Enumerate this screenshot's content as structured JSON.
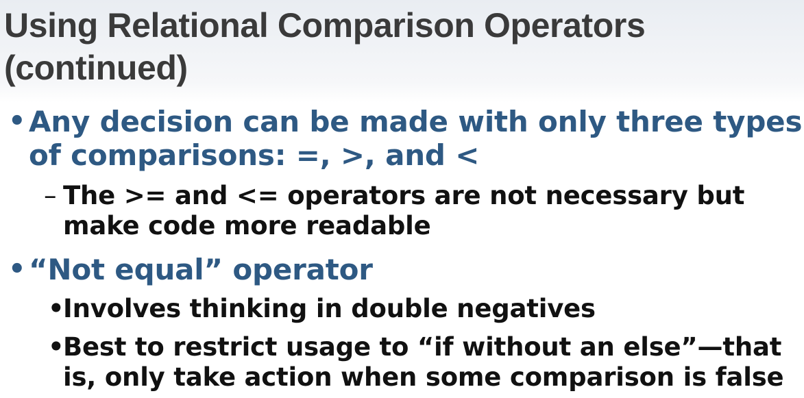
{
  "slide": {
    "title_line1": "Using Relational Comparison Operators",
    "title_line2": "(continued)",
    "bullets": [
      {
        "marker": "•",
        "line1": "Any decision can be made with only three types",
        "line2": "of comparisons: =, >, and <"
      },
      {
        "marker": "–",
        "line1": "The >= and <= operators are not necessary but",
        "line2": "make code more readable"
      },
      {
        "marker": "•",
        "line1": "“Not equal” operator"
      },
      {
        "marker": "•",
        "line1": "Involves thinking in double negatives"
      },
      {
        "marker": "•",
        "line1": "Best to restrict usage to “if without an else”—that",
        "line2": "is, only take action when some comparison is false"
      }
    ]
  },
  "colors": {
    "title": "#3a3a3a",
    "level1": "#2e5983",
    "level2": "#111111"
  }
}
